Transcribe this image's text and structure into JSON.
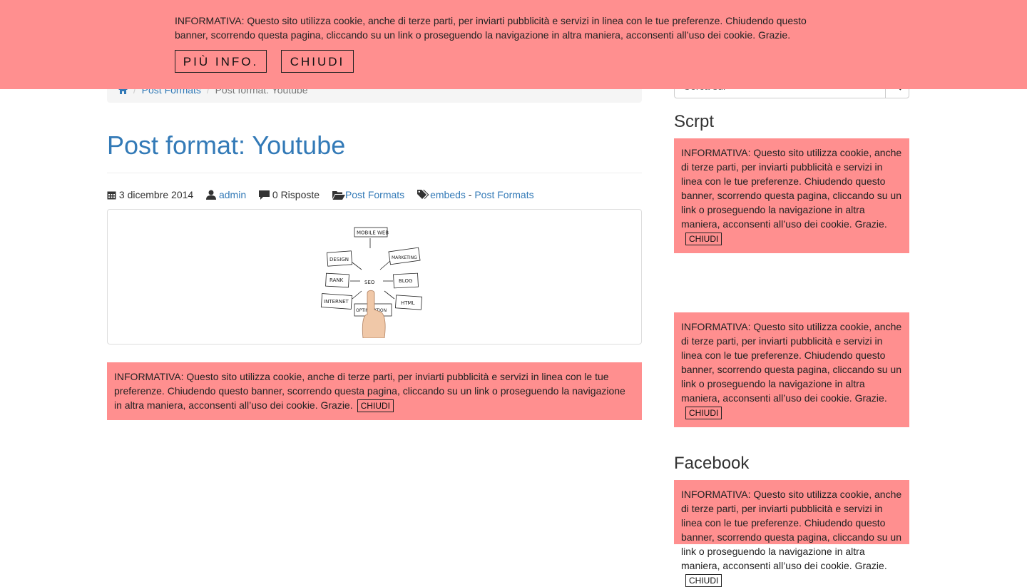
{
  "top_banner": {
    "message": "INFORMATIVA: Questo sito utilizza cookie, anche di terze parti, per inviarti pubblicità e servizi in linea con le tue preferenze. Chiudendo questo banner, scorrendo questa pagina, cliccando su un link o proseguendo la navigazione in altra maniera, acconsenti all’uso dei cookie. Grazie.",
    "info_label": "PIÙ INFO.",
    "close_label": "CHIUDI"
  },
  "breadcrumb": {
    "items": [
      "Post Formats",
      "Post format: Youtube"
    ]
  },
  "search": {
    "placeholder": "Cerca sul"
  },
  "post": {
    "title": "Post format: Youtube",
    "date": "3 dicembre 2014",
    "author": "admin",
    "replies": "0 Risposte",
    "category": "Post Formats",
    "tag1": "embeds",
    "tag_sep": " - ",
    "tag2": "Post Formats"
  },
  "thumbnail": {
    "words": [
      "MOBILE WEB",
      "DESIGN",
      "MARKETING",
      "RANK",
      "SEO",
      "BLOG",
      "INTERNET",
      "HTML",
      "OPTIMIZATION"
    ]
  },
  "cookie_notice": {
    "text": "INFORMATIVA: Questo sito utilizza cookie, anche di terze parti, per inviarti pubblicità e servizi in linea con le tue preferenze. Chiudendo questo banner, scorrendo questa pagina, cliccando su un link o proseguendo la navigazione in altra maniera, acconsenti all’uso dei cookie. Grazie.",
    "close_label": "CHIUDI"
  },
  "sidebar": {
    "widget1_title": "Scrpt",
    "widget2_title": "Facebook"
  },
  "colors": {
    "banner_bg": "#ff8f8f",
    "link": "#337ab7"
  }
}
